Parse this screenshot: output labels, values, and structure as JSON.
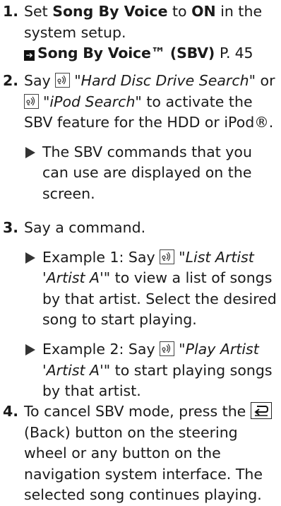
{
  "steps": [
    {
      "number": "1.",
      "line_a": "Set ",
      "setting_name": "Song By Voice",
      "line_b": " to ",
      "setting_value": "ON",
      "line_c": " in the system setup.",
      "reference": {
        "title": "Song By Voice™ (SBV)",
        "page": "P. 45"
      }
    },
    {
      "number": "2.",
      "say": "Say ",
      "cmd1": "\"Hard Disc Drive Search\"",
      "or": " or ",
      "cmd2": "\"iPod Search\"",
      "rest": " to activate the SBV feature for the HDD or iPod®.",
      "note": "The SBV commands that you can use are displayed on the screen."
    },
    {
      "number": "3.",
      "text": "Say a command.",
      "examples": [
        {
          "prefix": "Example 1: Say ",
          "command": "\"List Artist 'Artist A'\"",
          "suffix": " to view a list of songs by that artist. Select the desired song to start playing."
        },
        {
          "prefix": "Example 2: Say ",
          "command": "\"Play Artist 'Artist A'\"",
          "suffix": " to start playing songs by that artist."
        }
      ]
    },
    {
      "number": "4.",
      "text_a": "To cancel SBV mode, press the ",
      "back_label": "(Back)",
      "text_b": " button on the steering wheel or any button on the navigation system interface. The selected song continues playing."
    }
  ],
  "icons": {
    "voice": "voice-command-icon",
    "back": "back-button-icon",
    "reference": "page-reference-arrow-icon",
    "bullet": "triangle-bullet-icon"
  }
}
